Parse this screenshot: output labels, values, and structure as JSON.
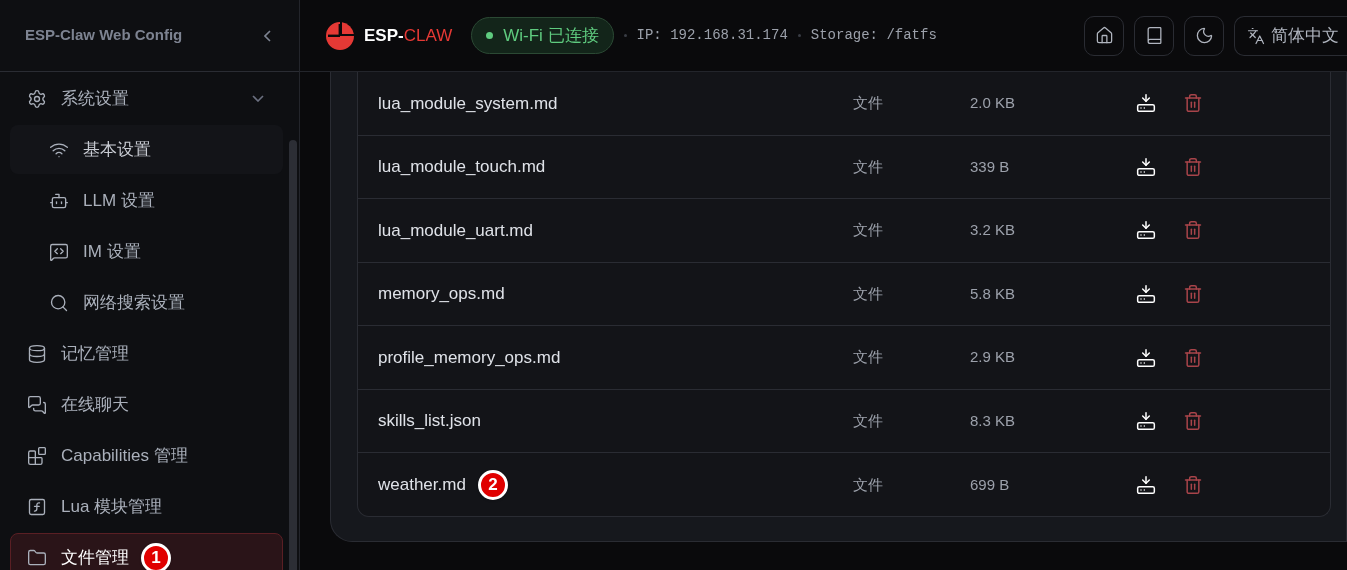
{
  "sidebar": {
    "title": "ESP-Claw Web Config",
    "items": [
      {
        "label": "系统设置",
        "selected": false,
        "expanded": true,
        "children": [
          {
            "label": "基本设置",
            "selected": true
          },
          {
            "label": "LLM 设置",
            "selected": false
          },
          {
            "label": "IM 设置",
            "selected": false
          },
          {
            "label": "网络搜索设置",
            "selected": false
          }
        ]
      },
      {
        "label": "记忆管理",
        "selected": false
      },
      {
        "label": "在线聊天",
        "selected": false
      },
      {
        "label": "Capabilities 管理",
        "selected": false
      },
      {
        "label": "Lua 模块管理",
        "selected": false
      },
      {
        "label": "文件管理",
        "selected": true,
        "annotation": "1"
      }
    ]
  },
  "header": {
    "logo": {
      "part_1": "ESP-",
      "part_2": "CLAW"
    },
    "wifi_status": {
      "label": "Wi-Fi 已连接",
      "connected": true
    },
    "ip": "IP: 192.168.31.174",
    "storage": "Storage: /fatfs",
    "language": "简体中文"
  },
  "files": [
    {
      "name": "lua_module_system.md",
      "type": "文件",
      "size": "2.0 KB"
    },
    {
      "name": "lua_module_touch.md",
      "type": "文件",
      "size": "339 B"
    },
    {
      "name": "lua_module_uart.md",
      "type": "文件",
      "size": "3.2 KB"
    },
    {
      "name": "memory_ops.md",
      "type": "文件",
      "size": "5.8 KB"
    },
    {
      "name": "profile_memory_ops.md",
      "type": "文件",
      "size": "2.9 KB"
    },
    {
      "name": "skills_list.json",
      "type": "文件",
      "size": "8.3 KB"
    },
    {
      "name": "weather.md",
      "type": "文件",
      "size": "699 B",
      "annotation": "2"
    }
  ]
}
